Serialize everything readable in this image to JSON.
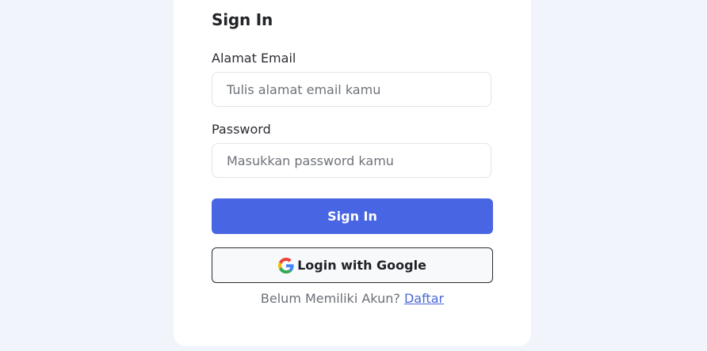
{
  "form": {
    "title": "Sign In",
    "email_label": "Alamat Email",
    "email_placeholder": "Tulis alamat email kamu",
    "email_value": "",
    "password_label": "Password",
    "password_placeholder": "Masukkan password kamu",
    "password_value": "",
    "signin_button": "Sign In",
    "google_button": "Login with Google",
    "google_icon": "google-icon",
    "footer_text": "Belum Memiliki Akun?",
    "register_link": "Daftar"
  },
  "colors": {
    "page_background": "#f1f4fb",
    "card_background": "#ffffff",
    "primary_button": "#4866e3",
    "link": "#4a67d6"
  }
}
